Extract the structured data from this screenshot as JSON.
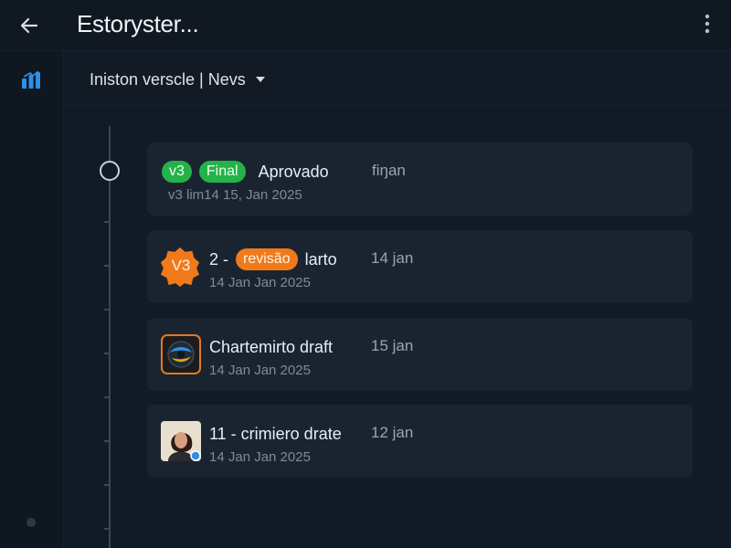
{
  "header": {
    "title": "Estoryster..."
  },
  "subheader": {
    "version_label": "Iniston verscle | Nevs"
  },
  "entries": [
    {
      "badge_v": "v3",
      "badge_status": "Final",
      "title": "Aprovado",
      "date_short": "fiŋan",
      "date_long": "v3 lim14 15, Jan 2025"
    },
    {
      "avatar_label": "V3",
      "prefix": "2 -",
      "badge_status": "revisão",
      "title": "larto",
      "date_short": "14 jan",
      "date_long": "14 Jan Jan 2025"
    },
    {
      "title": "Chartemirto draft",
      "date_short": "15 jan",
      "date_long": "14 Jan Jan 2025"
    },
    {
      "title": "11 - crimiero drate",
      "date_short": "12 jan",
      "date_long": "14 Jan Jan 2025"
    }
  ],
  "colors": {
    "background": "#111b27",
    "card": "#1a2431",
    "green": "#25b24a",
    "orange": "#f07a1a",
    "accent_blue": "#2f8ee5"
  },
  "icons": {
    "back": "arrow-left-icon",
    "menu": "more-vertical-icon",
    "rail": "stats-icon",
    "dropdown": "caret-down-icon"
  }
}
